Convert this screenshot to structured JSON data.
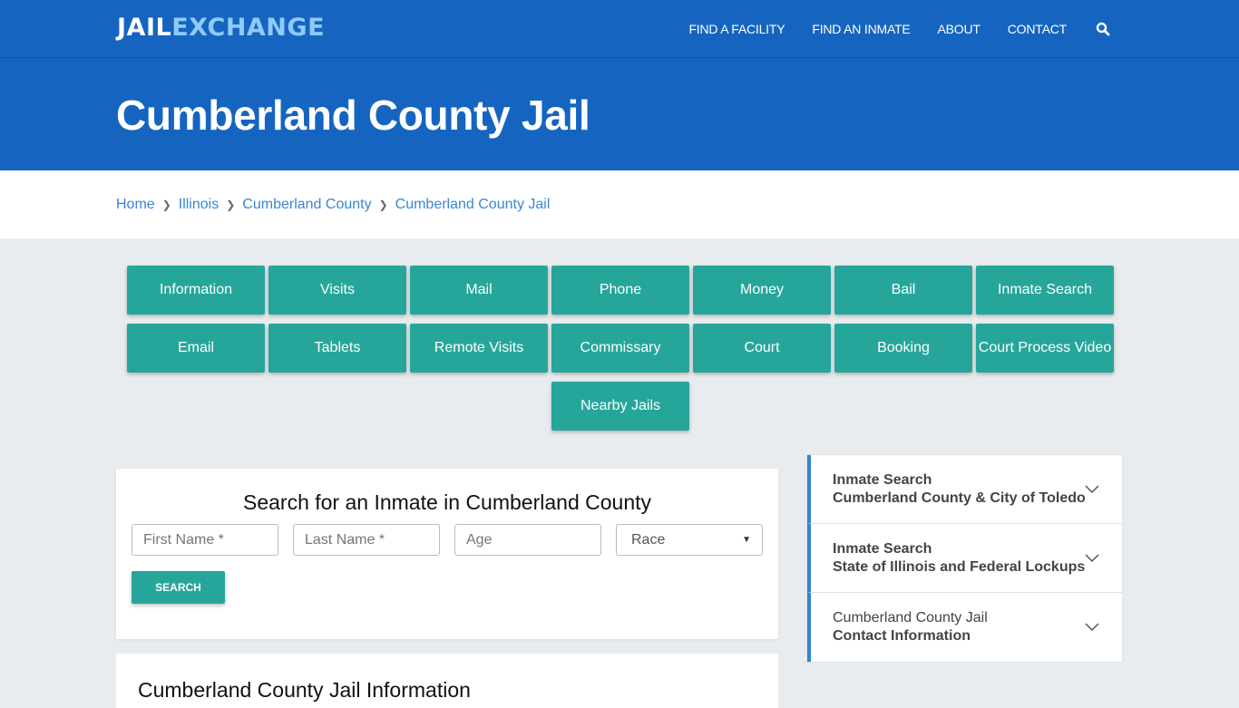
{
  "header": {
    "logo_part1": "JAIL",
    "logo_part2": "EXCHANGE",
    "nav": [
      "FIND A FACILITY",
      "FIND AN INMATE",
      "ABOUT",
      "CONTACT"
    ],
    "search_icon": "search-icon"
  },
  "hero": {
    "title": "Cumberland County Jail"
  },
  "breadcrumb": [
    "Home",
    "Illinois",
    "Cumberland County",
    "Cumberland County Jail"
  ],
  "tabs": [
    "Information",
    "Visits",
    "Mail",
    "Phone",
    "Money",
    "Bail",
    "Inmate Search",
    "Email",
    "Tablets",
    "Remote Visits",
    "Commissary",
    "Court",
    "Booking",
    "Court Process Video",
    "Nearby Jails"
  ],
  "search": {
    "title": "Search for an Inmate in Cumberland County",
    "first_name_placeholder": "First Name *",
    "last_name_placeholder": "Last Name *",
    "age_placeholder": "Age",
    "race_selected": "Race",
    "button": "SEARCH"
  },
  "info": {
    "title": "Cumberland County Jail Information"
  },
  "accordion": [
    {
      "line1": "Inmate Search",
      "line2": "Cumberland County & City of Toledo",
      "line1_bold": true
    },
    {
      "line1": "Inmate Search",
      "line2": "State of Illinois and Federal Lockups",
      "line1_bold": true
    },
    {
      "line1": "Cumberland County Jail",
      "line2": "Contact Information",
      "line1_bold": false
    }
  ],
  "colors": {
    "brand_blue": "#1565c0",
    "teal": "#26a69a",
    "link": "#3a86d1",
    "accent_bar": "#2f86d2"
  }
}
